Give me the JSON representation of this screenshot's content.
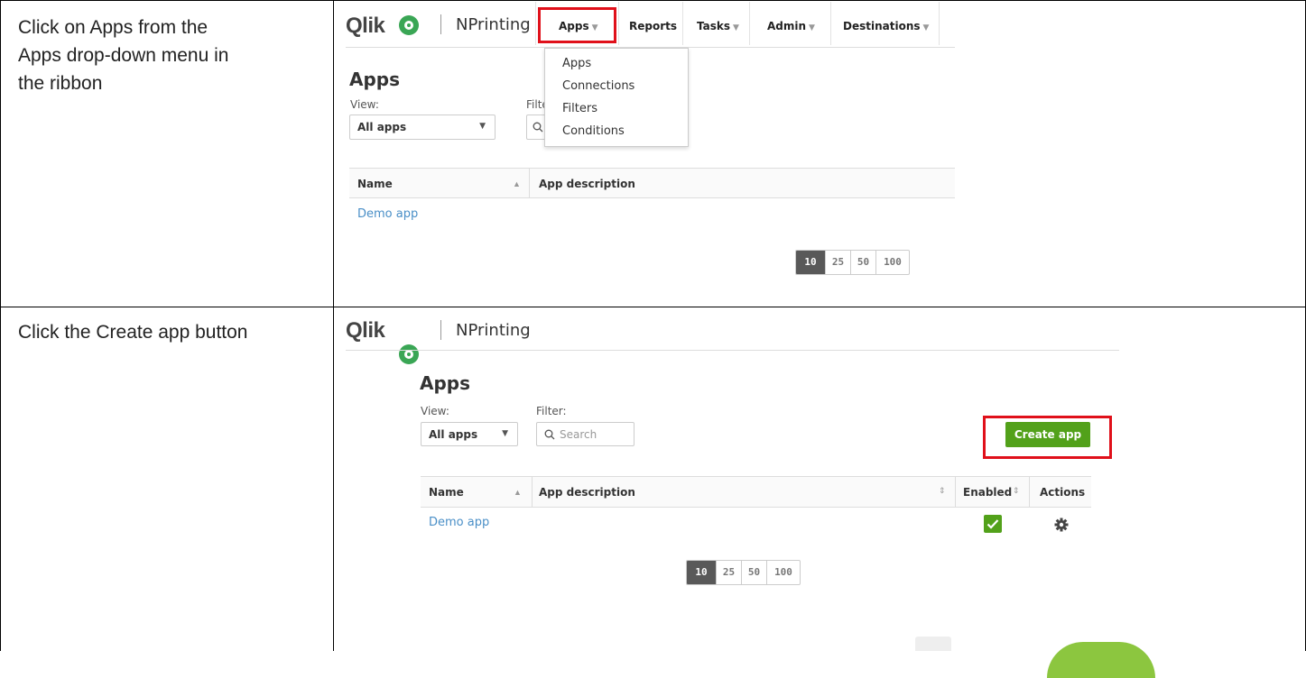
{
  "steps": [
    {
      "instruction": "Click on Apps from the Apps drop-down menu in the ribbon",
      "instruction_lines": [
        "Click on Apps from the",
        "Apps drop-down menu in",
        "the ribbon"
      ]
    },
    {
      "instruction": "Click the Create app button"
    }
  ],
  "brand": {
    "logo": "Qlik",
    "product": "NPrinting",
    "accent": "#52a11a",
    "highlight": "#e0101a"
  },
  "nav": {
    "items": [
      {
        "label": "Apps",
        "caret": "▼"
      },
      {
        "label": "Reports"
      },
      {
        "label": "Tasks",
        "caret": "▼"
      },
      {
        "label": "Admin",
        "caret": "▼"
      },
      {
        "label": "Destinations",
        "caret": "▼"
      }
    ]
  },
  "apps_menu": [
    "Apps",
    "Connections",
    "Filters",
    "Conditions"
  ],
  "page": {
    "title": "Apps",
    "view_label": "View:",
    "view_value": "All apps",
    "filter_label": "Filter:",
    "filter_label_clipped": "Filte",
    "search_placeholder": "Search",
    "create_button": "Create app"
  },
  "table": {
    "columns": [
      "Name",
      "App description",
      "Enabled",
      "Actions"
    ],
    "rows": [
      {
        "name": "Demo app",
        "enabled": true
      }
    ]
  },
  "pagination": [
    "10",
    "25",
    "50",
    "100"
  ],
  "icons": [
    "search-icon",
    "gear-icon",
    "check-icon",
    "sort-asc-icon",
    "sort-both-icon",
    "dropdown-caret-icon"
  ]
}
